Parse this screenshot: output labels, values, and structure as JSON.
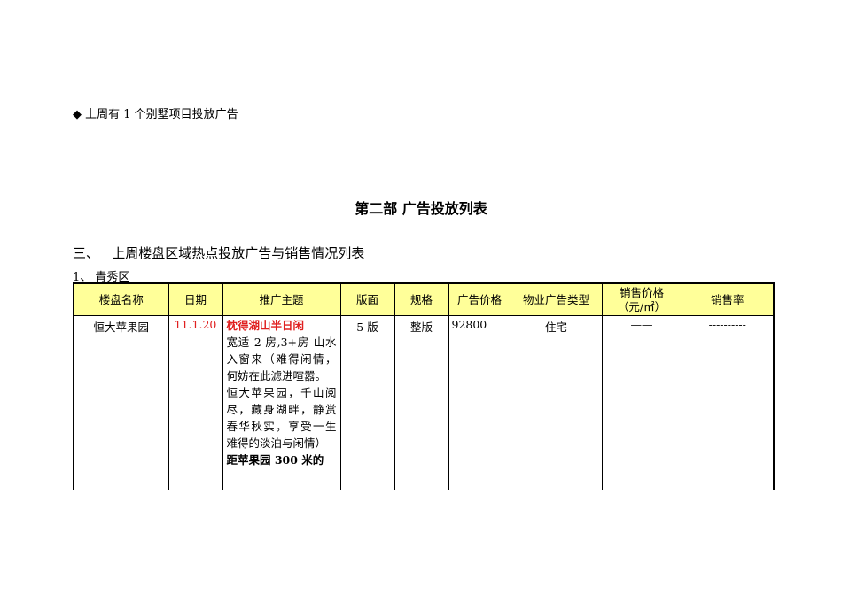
{
  "bullet_text": "上周有 1 个别墅项目投放广告",
  "part_title": "第二部  广告投放列表",
  "section_heading": "三、   上周楼盘区域热点投放广告与销售情况列表",
  "subsection": "1、 青秀区",
  "table": {
    "headers": [
      "楼盘名称",
      "日期",
      "推广主题",
      "版面",
      "规格",
      "广告价格",
      "物业广告类型",
      "销售价格",
      "（元/㎡）",
      "销售率"
    ],
    "rows": [
      {
        "name": "恒大苹果园",
        "date": "11.1.20",
        "theme_title": "枕得湖山半日闲",
        "theme_lines": [
          "宽适 2 房,3+房  山水入窗来（难得闲情，何妨在此滤进喧嚣。",
          "恒大苹果园，千山阅尽，藏身湖畔，静赏春华秋实，享受一生难得的淡泊与闲情）"
        ],
        "theme_bold": "距苹果园 300 米的",
        "page": "5 版",
        "size": "整版",
        "price": "92800",
        "type": "住宅",
        "sale_price": "——",
        "sale_rate": "----------"
      }
    ]
  }
}
